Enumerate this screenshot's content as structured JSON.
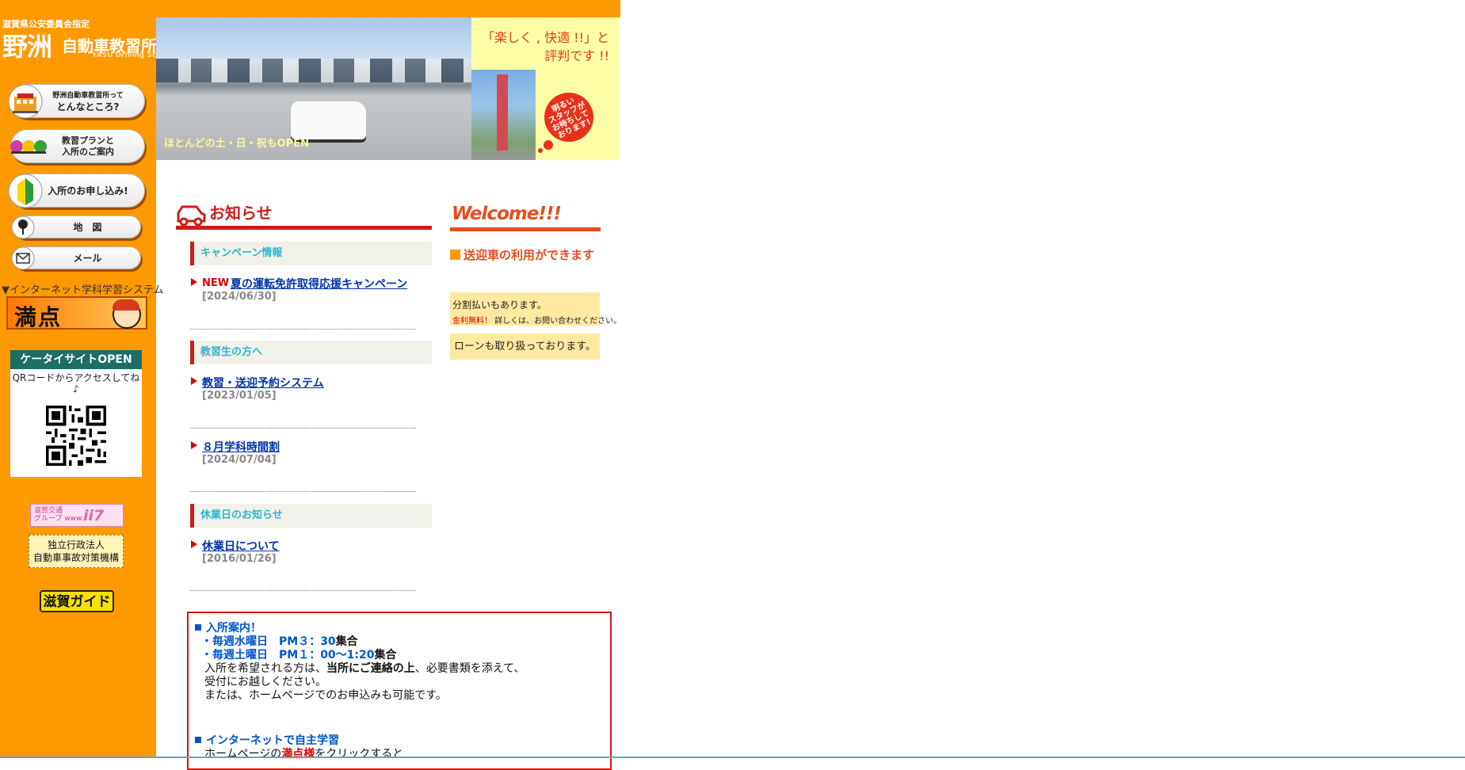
{
  "logo": {
    "subtitle": "滋賀県公安委員会指定",
    "brand": "野洲",
    "brand_rest": "自動車教習所",
    "english": "YASU Driving School"
  },
  "nav": [
    {
      "line1": "野洲自動車教習所って",
      "line2": "とんなところ?",
      "icon": "school-building-icon"
    },
    {
      "line1": "教習プランと",
      "line2": "入所のご案内",
      "icon": "cars-icon"
    },
    {
      "line1": "入所のお申し込み!",
      "line2": "",
      "icon": "beginner-mark-icon"
    },
    {
      "line1": "地　図",
      "line2": "",
      "icon": "map-pin-icon"
    },
    {
      "line1": "メール",
      "line2": "",
      "icon": "mail-icon"
    }
  ],
  "elearning": {
    "title": "▼インターネット学科学習システム",
    "banner": "満点"
  },
  "mobile": {
    "header": "ケータイサイトOPEN",
    "text": "QRコードからアクセスしてね♪"
  },
  "banners": {
    "iina_left": "滋賀交通\nグループ www.",
    "iina_right": "ii7",
    "nasva_line1": "独立行政法人",
    "nasva_line2": "自動車事故対策機構",
    "shiga_guide": "滋賀ガイド"
  },
  "header": {
    "photo_caption": "ほとんどの土・日・祝もOPEN",
    "slogan_line1": "「楽しく , 快適 !!」と",
    "slogan_line2": "評判です !!",
    "bubble": "明るい\nスタッフが\nお待ちして\nおります!"
  },
  "news": {
    "title": "お知らせ",
    "categories": [
      {
        "name": "キャンペーン情報",
        "items": [
          {
            "badge": "NEW",
            "title": "夏の運転免許取得応援キャンペーン",
            "date": "[2024/06/30]"
          }
        ]
      },
      {
        "name": "教習生の方へ",
        "items": [
          {
            "badge": "",
            "title": "教習・送迎予約システム",
            "date": "[2023/01/05]"
          },
          {
            "badge": "",
            "title": "８月学科時間割",
            "date": "[2024/07/04]"
          }
        ]
      },
      {
        "name": "休業日のお知らせ",
        "items": [
          {
            "badge": "",
            "title": "休業日について",
            "date": "[2016/01/26]"
          }
        ]
      }
    ]
  },
  "welcome": {
    "title": "Welcome!!!",
    "shuttle": "送迎車の利用ができます",
    "installment": "分割払いもあります。",
    "installment_red": "金利無料！",
    "installment_note": "詳しくは、お問い合わせください。",
    "loan": "ローンも取り扱っております。"
  },
  "info": {
    "heading1": "入所案内！",
    "wed_day": "・毎週水曜日　PM３：30",
    "wed_suffix": "集合",
    "sat_day": "・毎週土曜日　PM１：00～1:20",
    "sat_suffix": "集合",
    "text1a": "入所を希望される方は、",
    "text1b": "当所にご連絡の上",
    "text1c": "、必要書類を添えて、",
    "text2": "受付にお越しください。",
    "text3": "または、ホームページでのお申込みも可能です。",
    "heading2": "インターネットで自主学習",
    "text4a": "ホームページの",
    "text4b": "満点様",
    "text4c": "をクリックすると"
  },
  "colors": {
    "orange": "#ff9900",
    "red": "#cc1d1d",
    "link": "#0033aa"
  }
}
